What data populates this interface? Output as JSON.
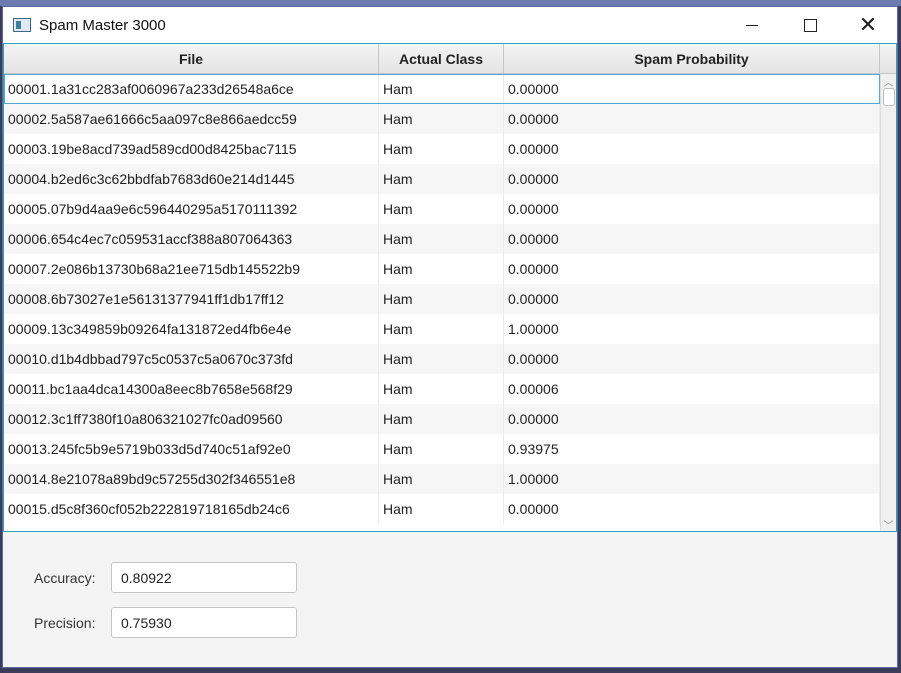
{
  "window": {
    "title": "Spam Master 3000"
  },
  "table": {
    "columns": [
      "File",
      "Actual Class",
      "Spam Probability"
    ],
    "rows": [
      [
        "00001.1a31cc283af0060967a233d26548a6ce",
        "Ham",
        "0.00000"
      ],
      [
        "00002.5a587ae61666c5aa097c8e866aedcc59",
        "Ham",
        "0.00000"
      ],
      [
        "00003.19be8acd739ad589cd00d8425bac7115",
        "Ham",
        "0.00000"
      ],
      [
        "00004.b2ed6c3c62bbdfab7683d60e214d1445",
        "Ham",
        "0.00000"
      ],
      [
        "00005.07b9d4aa9e6c596440295a5170111392",
        "Ham",
        "0.00000"
      ],
      [
        "00006.654c4ec7c059531accf388a807064363",
        "Ham",
        "0.00000"
      ],
      [
        "00007.2e086b13730b68a21ee715db145522b9",
        "Ham",
        "0.00000"
      ],
      [
        "00008.6b73027e1e56131377941ff1db17ff12",
        "Ham",
        "0.00000"
      ],
      [
        "00009.13c349859b09264fa131872ed4fb6e4e",
        "Ham",
        "1.00000"
      ],
      [
        "00010.d1b4dbbad797c5c0537c5a0670c373fd",
        "Ham",
        "0.00000"
      ],
      [
        "00011.bc1aa4dca14300a8eec8b7658e568f29",
        "Ham",
        "0.00006"
      ],
      [
        "00012.3c1ff7380f10a806321027fc0ad09560",
        "Ham",
        "0.00000"
      ],
      [
        "00013.245fc5b9e5719b033d5d740c51af92e0",
        "Ham",
        "0.93975"
      ],
      [
        "00014.8e21078a89bd9c57255d302f346551e8",
        "Ham",
        "1.00000"
      ],
      [
        "00015.d5c8f360cf052b222819718165db24c6",
        "Ham",
        "0.00000"
      ]
    ]
  },
  "stats": {
    "accuracy_label": "Accuracy:",
    "accuracy_value": "0.80922",
    "precision_label": "Precision:",
    "precision_value": "0.75930"
  },
  "icons": {
    "app": "app-window-icon",
    "minimize": "minimize-icon",
    "maximize": "maximize-icon",
    "close": "close-icon"
  },
  "colors": {
    "accent": "#2aa4b8",
    "selection": "#52a8d6"
  }
}
